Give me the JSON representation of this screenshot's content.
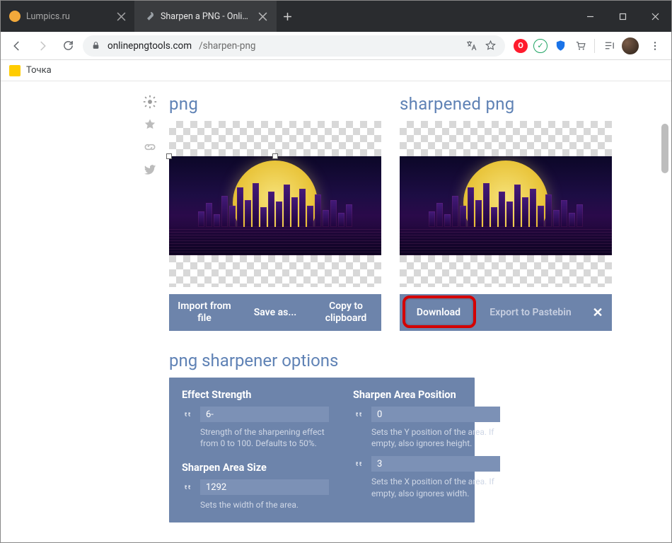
{
  "window": {
    "tabs": [
      {
        "title": "Lumpics.ru",
        "active": false,
        "favColor": "#f2a93b"
      },
      {
        "title": "Sharpen a PNG - Online PNG Too",
        "active": true,
        "favType": "wrench"
      }
    ]
  },
  "omnibox": {
    "domain": "onlinepngtools.com",
    "path": "/sharpen-png"
  },
  "bookmarks": {
    "item1": "Точка"
  },
  "left_panel": {
    "title": "png",
    "buttons": {
      "import": "Import from file",
      "saveas": "Save as...",
      "copy": "Copy to clipboard"
    }
  },
  "right_panel": {
    "title": "sharpened png",
    "buttons": {
      "download": "Download",
      "export": "Export to Pastebin"
    }
  },
  "options": {
    "title": "png sharpener options",
    "strength": {
      "label": "Effect Strength",
      "value": "6-",
      "desc": "Strength of the sharpening effect from 0 to 100. Defaults to 50%."
    },
    "size": {
      "label": "Sharpen Area Size",
      "width_value": "1292",
      "width_desc": "Sets the width of the area."
    },
    "position": {
      "label": "Sharpen Area Position",
      "y_value": "0",
      "y_desc": "Sets the Y position of the area. If empty, also ignores height.",
      "x_value": "3",
      "x_desc": "Sets the X position of the area. If empty, also ignores width."
    }
  }
}
